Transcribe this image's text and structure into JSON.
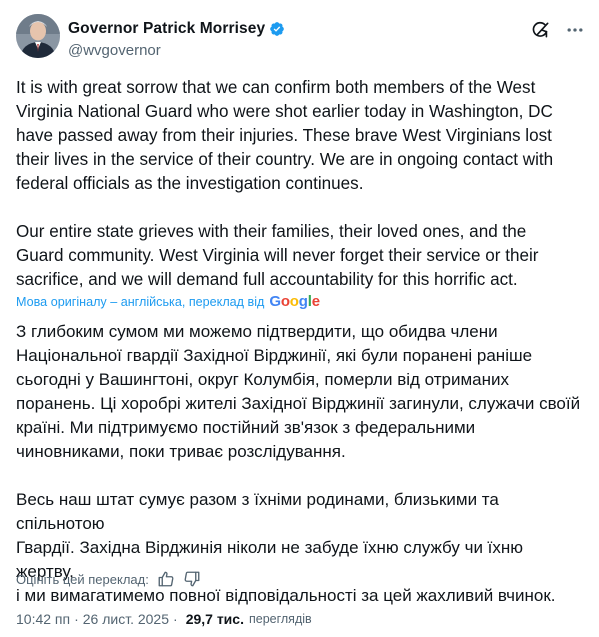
{
  "author": {
    "display_name": "Governor Patrick Morrisey",
    "handle": "@wvgovernor",
    "verified": true,
    "avatar_icon": "profile-photo"
  },
  "header_actions": {
    "grok_icon": "grok-icon",
    "more_icon": "more-icon"
  },
  "tweet": {
    "paragraphs": [
      "It is with great sorrow that we can confirm both members of the West\nVirginia National Guard who were shot earlier today in Washington, DC\nhave passed away from their injuries. These brave West Virginians lost\ntheir lives in the service of their country. We are in ongoing contact with\nfederal officials as the investigation continues.",
      "Our entire state grieves with their families, their loved ones, and the\nGuard community. West Virginia will never forget their service or their\nsacrifice, and we will demand full accountability for this horrific act."
    ]
  },
  "translation": {
    "note": "Мова оригіналу – англійська, переклад від",
    "provider": "Google",
    "paragraphs": [
      "З глибоким сумом ми можемо підтвердити, що обидва члени\nНаціональної гвардії Західної Вірджинії, які були поранені раніше\nсьогодні у Вашингтоні, округ Колумбія, померли від отриманих\nпоранень. Ці хоробрі жителі Західної Вірджинії загинули, служачи своїй\nкраїні. Ми підтримуємо постійний зв'язок з федеральними\nчиновниками, поки триває розслідування.",
      "Весь наш штат сумує разом з їхніми родинами, близькими та спільнотою\nГвардії. Західна Вірджинія ніколи не забуде їхню службу чи їхню жертву,\nі ми вимагатимемо повної відповідальності за цей жахливий вчинок."
    ],
    "rate_label": "Оцініть цей переклад:"
  },
  "meta": {
    "time": "10:42 пп",
    "separator": "·",
    "date": "26 лист. 2025",
    "views_count": "29,7 тис.",
    "views_label": "переглядів"
  },
  "colors": {
    "text": "#0f1419",
    "secondary": "#536471",
    "link": "#1d9bf0",
    "verified": "#1d9bf0"
  }
}
